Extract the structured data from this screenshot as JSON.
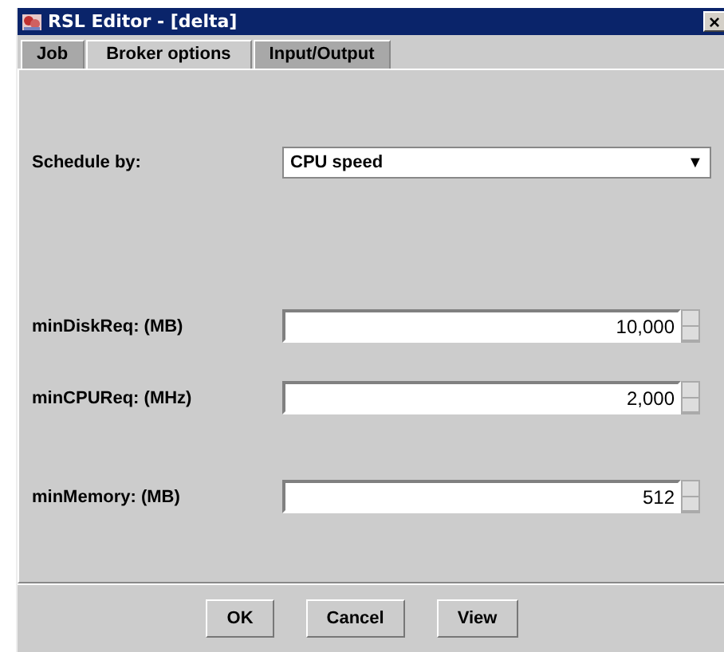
{
  "window": {
    "title": "RSL Editor - [delta]",
    "close": "×"
  },
  "tabs": [
    {
      "label": "Job",
      "selected": false
    },
    {
      "label": "Broker options",
      "selected": true
    },
    {
      "label": "Input/Output",
      "selected": false
    }
  ],
  "schedule": {
    "label": "Schedule by:",
    "value": "CPU speed",
    "arrow": "▼"
  },
  "spinners": [
    {
      "label": "minDiskReq: (MB)",
      "value": "10,000"
    },
    {
      "label": "minCPUReq: (MHz)",
      "value": "2,000"
    },
    {
      "label": "minMemory: (MB)",
      "value": "512"
    }
  ],
  "buttons": [
    "OK",
    "Cancel",
    "View"
  ]
}
